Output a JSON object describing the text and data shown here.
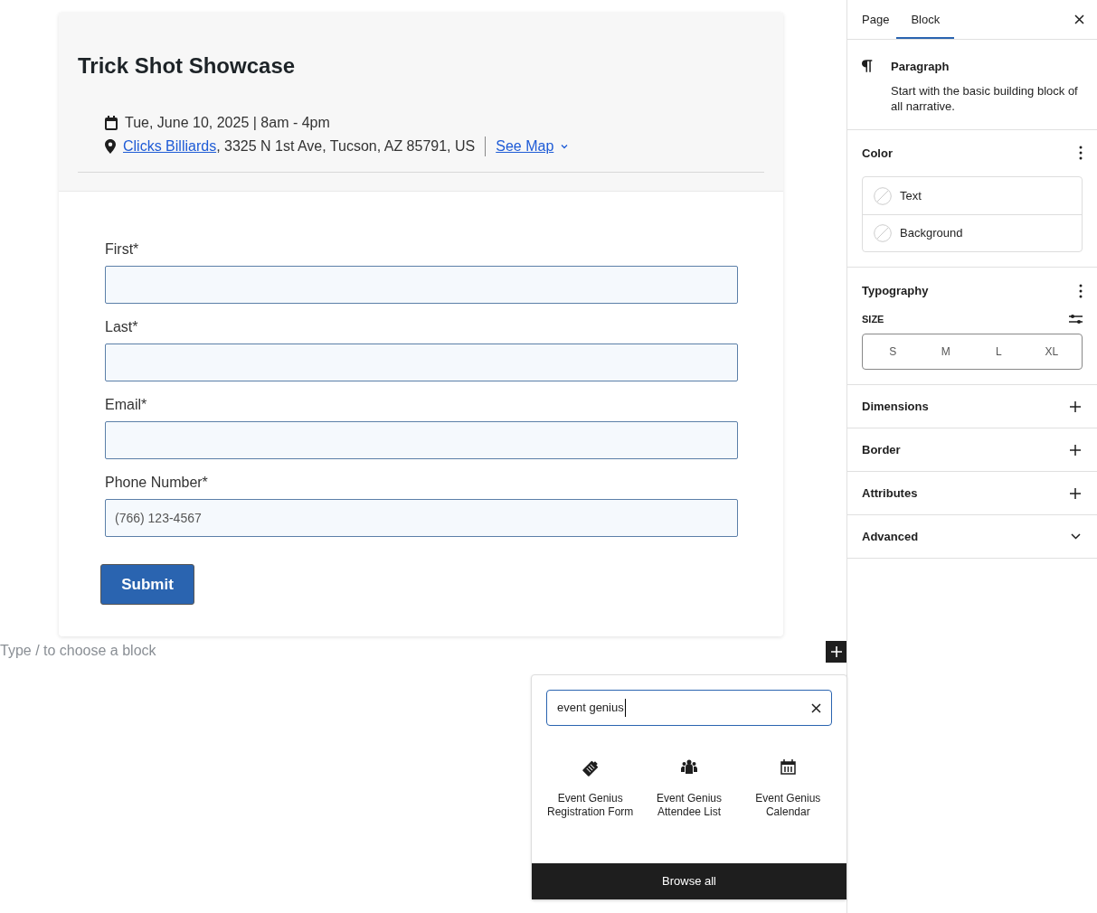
{
  "event": {
    "title": "Trick Shot Showcase",
    "datetime": "Tue, June 10, 2025 | 8am - 4pm",
    "venue_link": "Clicks Billiards",
    "address": ", 3325 N 1st Ave, Tucson, AZ 85791, US",
    "map_link": "See Map"
  },
  "form": {
    "fields": [
      {
        "label": "First*"
      },
      {
        "label": "Last*"
      },
      {
        "label": "Email*"
      },
      {
        "label": "Phone Number*",
        "placeholder": "(766) 123-4567"
      }
    ],
    "submit": "Submit"
  },
  "block_prompt": "Type / to choose a block",
  "inserter": {
    "search_value": "event genius",
    "results": [
      {
        "kind": "form",
        "label": "Event Genius Registration Form"
      },
      {
        "kind": "people",
        "label": "Event Genius Attendee List"
      },
      {
        "kind": "calendar",
        "label": "Event Genius Calendar"
      }
    ],
    "browse_all": "Browse all"
  },
  "sidebar": {
    "tabs": [
      {
        "label": "Page",
        "selected": false
      },
      {
        "label": "Block",
        "selected": true
      }
    ],
    "block": {
      "name": "Paragraph",
      "description": "Start with the basic building block of all narrative."
    },
    "color": {
      "title": "Color",
      "items": [
        "Text",
        "Background"
      ]
    },
    "typography": {
      "title": "Typography",
      "size_label": "SIZE",
      "sizes": [
        {
          "label": "S",
          "selected": false
        },
        {
          "label": "M",
          "selected": false
        },
        {
          "label": "L",
          "selected": false
        },
        {
          "label": "XL",
          "selected": false
        }
      ]
    },
    "panels": [
      {
        "title": "Dimensions",
        "kind": "plus"
      },
      {
        "title": "Border",
        "kind": "plus"
      },
      {
        "title": "Attributes",
        "kind": "plus"
      },
      {
        "title": "Advanced",
        "kind": "chevron"
      }
    ]
  }
}
